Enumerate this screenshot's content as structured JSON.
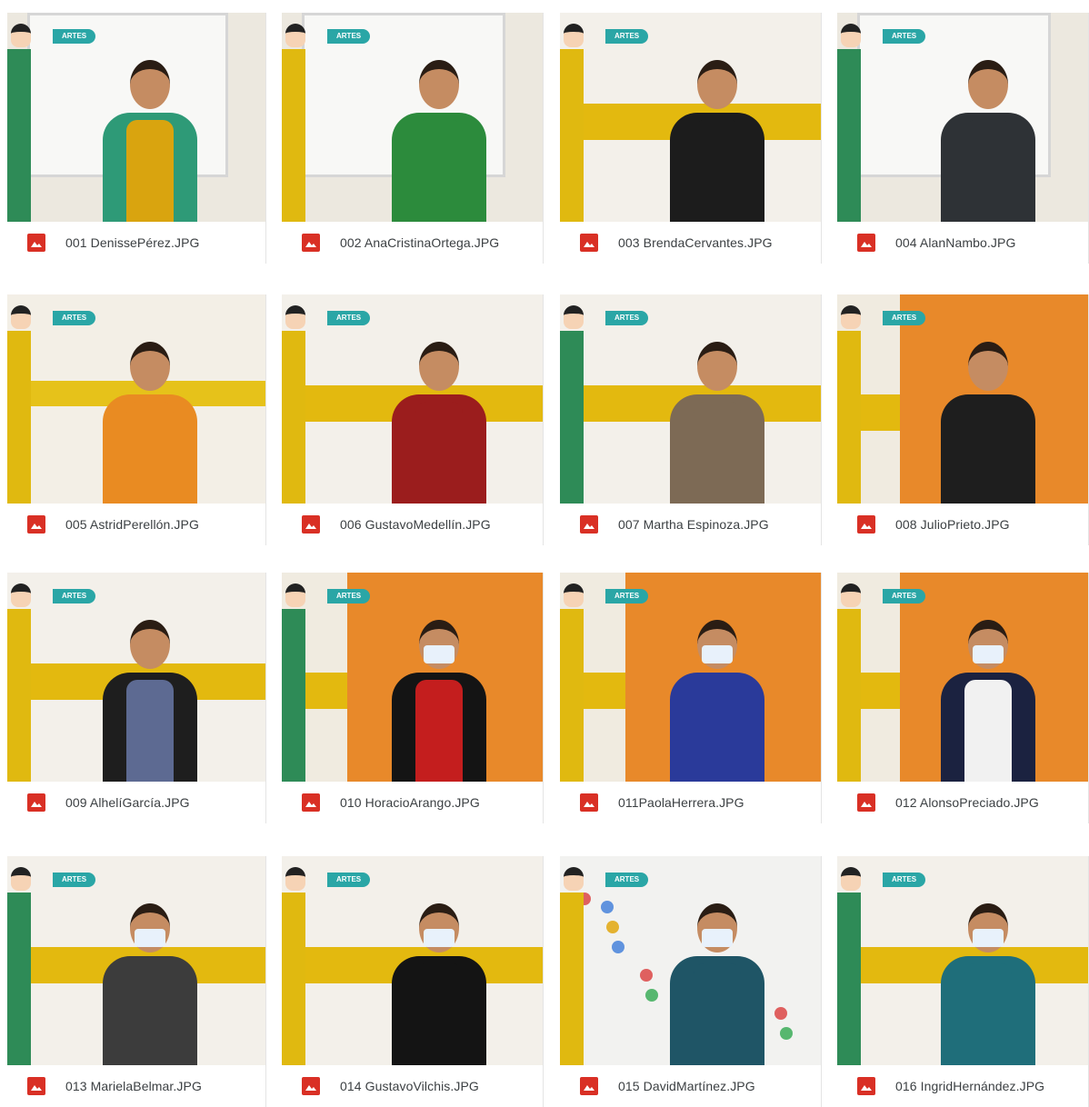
{
  "files": [
    {
      "name": "001 DenissePérez.JPG",
      "shirt": "#d9a40f",
      "jacket": "#2e9a77",
      "bg": "board",
      "mask": false
    },
    {
      "name": "002 AnaCristinaOrtega.JPG",
      "shirt": "#2c8b3c",
      "jacket": "#2c8b3c",
      "bg": "board",
      "mask": false
    },
    {
      "name": "003 BrendaCervantes.JPG",
      "shirt": "#1c1c1c",
      "jacket": "#1c1c1c",
      "bg": "stripe",
      "mask": false
    },
    {
      "name": "004 AlanNambo.JPG",
      "shirt": "#2e3236",
      "jacket": "#2e3236",
      "bg": "board",
      "mask": false
    },
    {
      "name": "005 AstridPerellón.JPG",
      "shirt": "#e98b22",
      "jacket": "#e98b22",
      "bg": "room",
      "mask": false
    },
    {
      "name": "006 GustavoMedellín.JPG",
      "shirt": "#9b1d1d",
      "jacket": "#9b1d1d",
      "bg": "stripe",
      "mask": false
    },
    {
      "name": "007 Martha Espinoza.JPG",
      "shirt": "#7d6a55",
      "jacket": "#7d6a55",
      "bg": "stripe",
      "mask": false
    },
    {
      "name": "008 JulioPrieto.JPG",
      "shirt": "#1e1e1e",
      "jacket": "#1e1e1e",
      "bg": "orange",
      "mask": false
    },
    {
      "name": "009 AlhelíGarcía.JPG",
      "shirt": "#5d6a92",
      "jacket": "#1e1e1e",
      "bg": "stripe",
      "mask": false
    },
    {
      "name": "010 HoracioArango.JPG",
      "shirt": "#c41e1e",
      "jacket": "#141414",
      "bg": "orange",
      "mask": true
    },
    {
      "name": "011PaolaHerrera.JPG",
      "shirt": "#2a3a9a",
      "jacket": "#2a3a9a",
      "bg": "orange",
      "mask": true
    },
    {
      "name": "012 AlonsoPreciado.JPG",
      "shirt": "#f1f1f1",
      "jacket": "#1b2240",
      "bg": "orange",
      "mask": true
    },
    {
      "name": "013 MarielaBelmar.JPG",
      "shirt": "#3c3c3c",
      "jacket": "#3c3c3c",
      "bg": "stripe",
      "mask": true
    },
    {
      "name": "014 GustavoVilchis.JPG",
      "shirt": "#141414",
      "jacket": "#141414",
      "bg": "stripe",
      "mask": true
    },
    {
      "name": "015 DavidMartínez.JPG",
      "shirt": "#1f5566",
      "jacket": "#1f5566",
      "bg": "hands",
      "mask": true
    },
    {
      "name": "016 IngridHernández.JPG",
      "shirt": "#1f6e7a",
      "jacket": "#1f6e7a",
      "bg": "stripe",
      "mask": true
    }
  ],
  "tag_text": "ARTES"
}
